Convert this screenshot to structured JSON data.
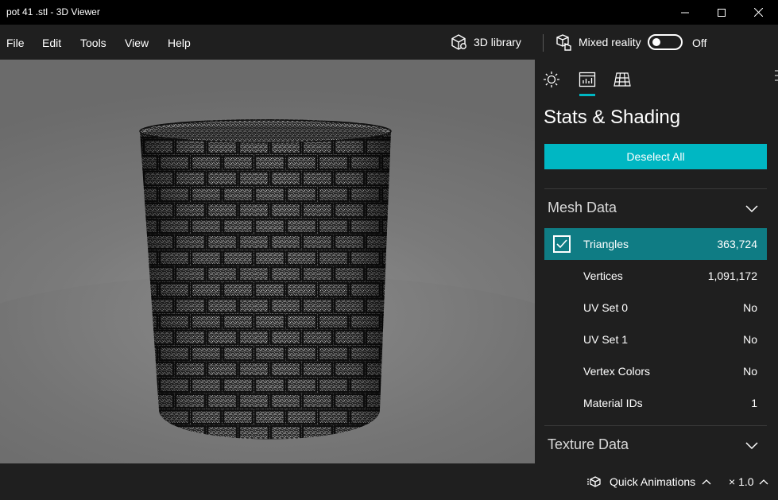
{
  "window": {
    "title": "pot 41 .stl - 3D Viewer"
  },
  "menu": {
    "items": [
      "File",
      "Edit",
      "Tools",
      "View",
      "Help"
    ],
    "library_label": "3D library",
    "mixed_reality_label": "Mixed reality",
    "mixed_reality_toggle": "Off"
  },
  "panel": {
    "title": "Stats & Shading",
    "deselect_label": "Deselect All",
    "mesh_section": "Mesh Data",
    "rows": [
      {
        "label": "Triangles",
        "value": "363,724",
        "checked": true
      },
      {
        "label": "Vertices",
        "value": "1,091,172"
      },
      {
        "label": "UV Set 0",
        "value": "No"
      },
      {
        "label": "UV Set 1",
        "value": "No"
      },
      {
        "label": "Vertex Colors",
        "value": "No"
      },
      {
        "label": "Material IDs",
        "value": "1"
      }
    ],
    "texture_section": "Texture Data"
  },
  "bottom": {
    "quick_animations": "Quick Animations",
    "speed": "× 1.0"
  },
  "colors": {
    "accent": "#00b7c3",
    "selected_row": "#0f7c84",
    "panel_bg": "#1f1f1f",
    "titlebar_bg": "#000000"
  }
}
